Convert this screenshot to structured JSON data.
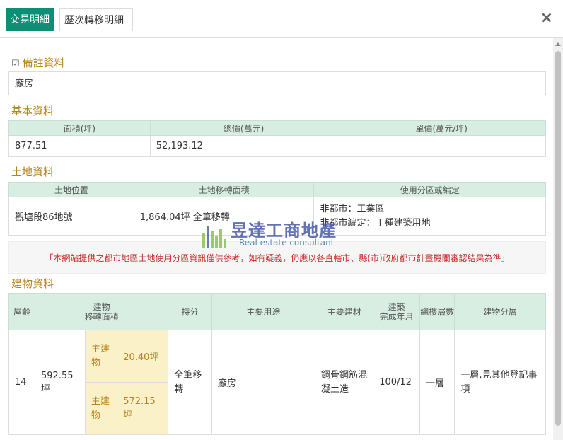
{
  "tabs": [
    {
      "label": "交易明細",
      "active": true
    },
    {
      "label": "歷次轉移明細",
      "active": false
    }
  ],
  "close_label": "×",
  "notes": {
    "title": "備註資料",
    "value": "廠房"
  },
  "basic": {
    "title": "基本資料",
    "headers": [
      "面積(坪)",
      "總價(萬元)",
      "單價(萬元/坪)"
    ],
    "values": [
      "877.51",
      "52,193.12",
      ""
    ]
  },
  "land": {
    "title": "土地資料",
    "headers": [
      "土地位置",
      "土地移轉面積",
      "使用分區或編定"
    ],
    "location": "觀塘段86地號",
    "area": "1,864.04坪 全筆移轉",
    "zoning_line1": "非都市：工業區",
    "zoning_line2": "非都市編定：丁種建築用地"
  },
  "disclaimer": "「本網站提供之都市地區土地使用分區資訊僅供參考，如有疑義，仍應以各直轄市、縣(市)政府都市計畫機關審認結果為準」",
  "watermark": {
    "title": "昱達工商地產",
    "subtitle": "Real estate consultant"
  },
  "building": {
    "title": "建物資料",
    "headers": {
      "age": "屋齡",
      "area": "建物\n移轉面積",
      "share": "持分",
      "use": "主要用途",
      "material": "主要建材",
      "completed": "建築\n完成年月",
      "floors": "總樓層數",
      "layers": "建物分層"
    },
    "row": {
      "age": "14",
      "total_area": "592.55坪",
      "sub1_label": "主建物",
      "sub1_value": "20.40坪",
      "sub2_label": "主建物",
      "sub2_value": "572.15坪",
      "share": "全筆移轉",
      "use": "廠房",
      "material": "鋼骨鋼筋混凝土造",
      "completed": "100/12",
      "floors": "一層",
      "layers": "一層,見其他登記事項"
    }
  }
}
